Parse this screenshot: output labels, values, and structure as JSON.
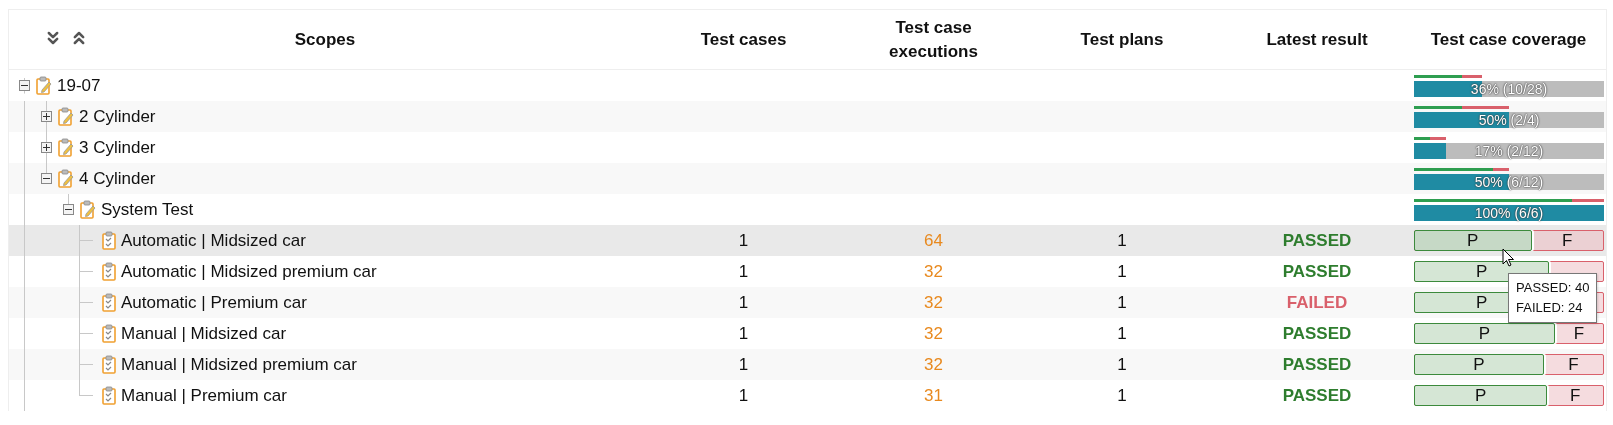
{
  "columns": [
    "Scopes",
    "Test cases",
    "Test case executions",
    "Test plans",
    "Latest result",
    "Test case coverage"
  ],
  "scopes": [
    {
      "kind": "group",
      "label": "19-07",
      "expanded": true,
      "coverage": {
        "level": 0.36,
        "label": "36% (10/28)"
      },
      "results_bar": {
        "level": 0.7
      },
      "children": [
        {
          "kind": "group",
          "label": "2 Cylinder",
          "expanded": false,
          "coverage": {
            "level": 0.5,
            "label": "50% (2/4)"
          },
          "results_bar": {
            "level": 0.5
          }
        },
        {
          "kind": "group",
          "label": "3 Cylinder",
          "expanded": false,
          "coverage": {
            "level": 0.17,
            "label": "17% (2/12)"
          },
          "results_bar": {
            "level": 0.5
          }
        },
        {
          "kind": "group",
          "label": "4 Cylinder",
          "expanded": true,
          "coverage": {
            "level": 0.5,
            "label": "50% (6/12)"
          },
          "results_bar": {
            "level": 0.83
          },
          "children": [
            {
              "kind": "group",
              "label": "System Test",
              "expanded": true,
              "coverage": {
                "level": 1,
                "label": "100% (6/6)"
              },
              "results_bar": {
                "level": 0.83
              },
              "children": [
                {
                  "kind": "test",
                  "label": "Automatic | Midsized car",
                  "hovered": true,
                  "test_cases": "1",
                  "executions": "64",
                  "test_plans": "1",
                  "result": {
                    "failed": false,
                    "label": "PASSED"
                  },
                  "coverage": {
                    "level": 0.625,
                    "passed_label": "P",
                    "failed_label": "F"
                  }
                },
                {
                  "kind": "test",
                  "label": "Automatic | Midsized premium car",
                  "hovered": false,
                  "test_cases": "1",
                  "executions": "32",
                  "test_plans": "1",
                  "result": {
                    "failed": false,
                    "label": "PASSED"
                  },
                  "coverage": {
                    "level": 0.72,
                    "passed_label": "P"
                  }
                },
                {
                  "kind": "test",
                  "label": "Automatic | Premium car",
                  "hovered": false,
                  "test_cases": "1",
                  "executions": "32",
                  "test_plans": "1",
                  "result": {
                    "failed": true,
                    "label": "FAILED"
                  },
                  "coverage": {
                    "level": 0.72,
                    "passed_label": "P"
                  }
                },
                {
                  "kind": "test",
                  "label": "Manual | Midsized car",
                  "hovered": false,
                  "test_cases": "1",
                  "executions": "32",
                  "test_plans": "1",
                  "result": {
                    "failed": false,
                    "label": "PASSED"
                  },
                  "coverage": {
                    "level": 0.75,
                    "passed_label": "P",
                    "failed_label": "F"
                  }
                },
                {
                  "kind": "test",
                  "label": "Manual | Midsized premium car",
                  "hovered": false,
                  "test_cases": "1",
                  "executions": "32",
                  "test_plans": "1",
                  "result": {
                    "failed": false,
                    "label": "PASSED"
                  },
                  "coverage": {
                    "level": 0.69,
                    "passed_label": "P",
                    "failed_label": "F"
                  }
                },
                {
                  "kind": "test",
                  "label": "Manual | Premium car",
                  "hovered": false,
                  "test_cases": "1",
                  "executions": "31",
                  "test_plans": "1",
                  "result": {
                    "failed": false,
                    "label": "PASSED"
                  },
                  "coverage": {
                    "level": 0.71,
                    "passed_label": "P",
                    "failed_label": "F"
                  }
                }
              ]
            }
          ]
        }
      ]
    }
  ],
  "tooltip": {
    "lines": [
      "PASSED: 40",
      "FAILED: 24"
    ]
  }
}
